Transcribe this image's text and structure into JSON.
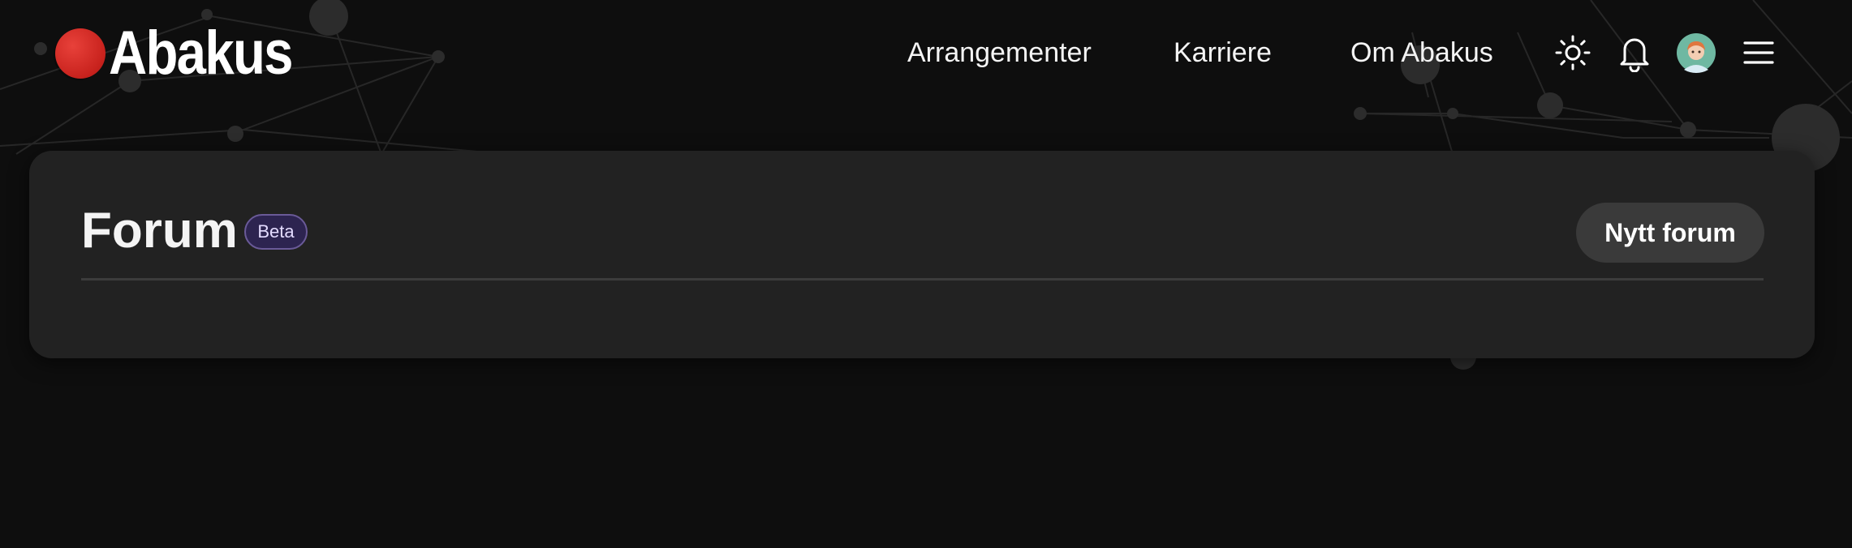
{
  "header": {
    "logo_text": "Abakus",
    "nav": [
      {
        "label": "Arrangementer"
      },
      {
        "label": "Karriere"
      },
      {
        "label": "Om Abakus"
      }
    ],
    "icons": [
      "sun-icon",
      "bell-icon",
      "avatar",
      "menu-icon"
    ]
  },
  "main": {
    "title": "Forum",
    "badge": "Beta",
    "new_forum_label": "Nytt forum"
  },
  "colors": {
    "background": "#0e0e0e",
    "card": "#222222",
    "brand_red": "#d32a24",
    "badge_bg": "#2d2450",
    "button_bg": "#3a3a3a"
  }
}
